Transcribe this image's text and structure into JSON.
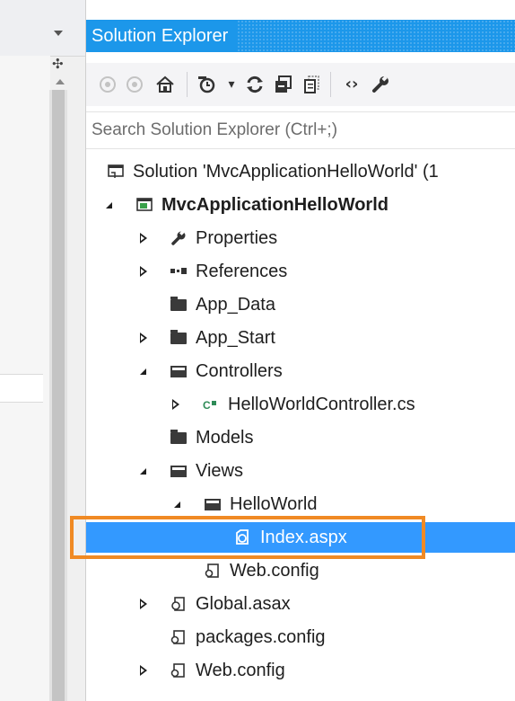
{
  "panel": {
    "title": "Solution Explorer",
    "accent_color": "#1c97ea",
    "selection_color": "#3399ff",
    "highlight_color": "#f08a24"
  },
  "toolbar": {
    "buttons": [
      {
        "name": "back-icon",
        "glyph": "◀"
      },
      {
        "name": "forward-icon",
        "glyph": "▶"
      },
      {
        "name": "home-icon",
        "glyph": "⌂"
      },
      {
        "name": "pending-changes-filter-icon",
        "glyph": "◷"
      },
      {
        "name": "dropdown-icon",
        "glyph": "▾"
      },
      {
        "name": "sync-icon",
        "glyph": "⟳"
      },
      {
        "name": "collapse-all-icon",
        "glyph": "▤"
      },
      {
        "name": "show-all-files-icon",
        "glyph": "▦"
      },
      {
        "name": "view-code-icon",
        "glyph": "‹›"
      },
      {
        "name": "properties-icon",
        "glyph": "🔧"
      }
    ]
  },
  "search": {
    "placeholder": "Search Solution Explorer (Ctrl+;)"
  },
  "tree": [
    {
      "label": "Solution 'MvcApplicationHelloWorld' (1",
      "icon": "solution-icon",
      "expander": "none",
      "level": 0
    },
    {
      "label": "MvcApplicationHelloWorld",
      "icon": "project-icon",
      "expander": "open",
      "level": 1,
      "bold": true
    },
    {
      "label": "Properties",
      "icon": "wrench-icon",
      "expander": "closed",
      "level": 2
    },
    {
      "label": "References",
      "icon": "references-icon",
      "expander": "closed",
      "level": 2
    },
    {
      "label": "App_Data",
      "icon": "folder-icon",
      "expander": "none",
      "level": 2
    },
    {
      "label": "App_Start",
      "icon": "folder-icon",
      "expander": "closed",
      "level": 2
    },
    {
      "label": "Controllers",
      "icon": "folder-open-icon",
      "expander": "open",
      "level": 2
    },
    {
      "label": "HelloWorldController.cs",
      "icon": "csharp-file-icon",
      "expander": "closed",
      "level": 3
    },
    {
      "label": "Models",
      "icon": "folder-icon",
      "expander": "none",
      "level": 2
    },
    {
      "label": "Views",
      "icon": "folder-open-icon",
      "expander": "open",
      "level": 2
    },
    {
      "label": "HelloWorld",
      "icon": "folder-open-icon",
      "expander": "open",
      "level": 3
    },
    {
      "label": "Index.aspx",
      "icon": "aspx-file-icon",
      "expander": "none",
      "level": 4,
      "selected": true
    },
    {
      "label": "Web.config",
      "icon": "config-file-icon",
      "expander": "none",
      "level": 3
    },
    {
      "label": "Global.asax",
      "icon": "asax-file-icon",
      "expander": "closed",
      "level": 2
    },
    {
      "label": "packages.config",
      "icon": "config-file-icon",
      "expander": "none",
      "level": 2
    },
    {
      "label": "Web.config",
      "icon": "config-file-icon",
      "expander": "closed",
      "level": 2
    }
  ]
}
